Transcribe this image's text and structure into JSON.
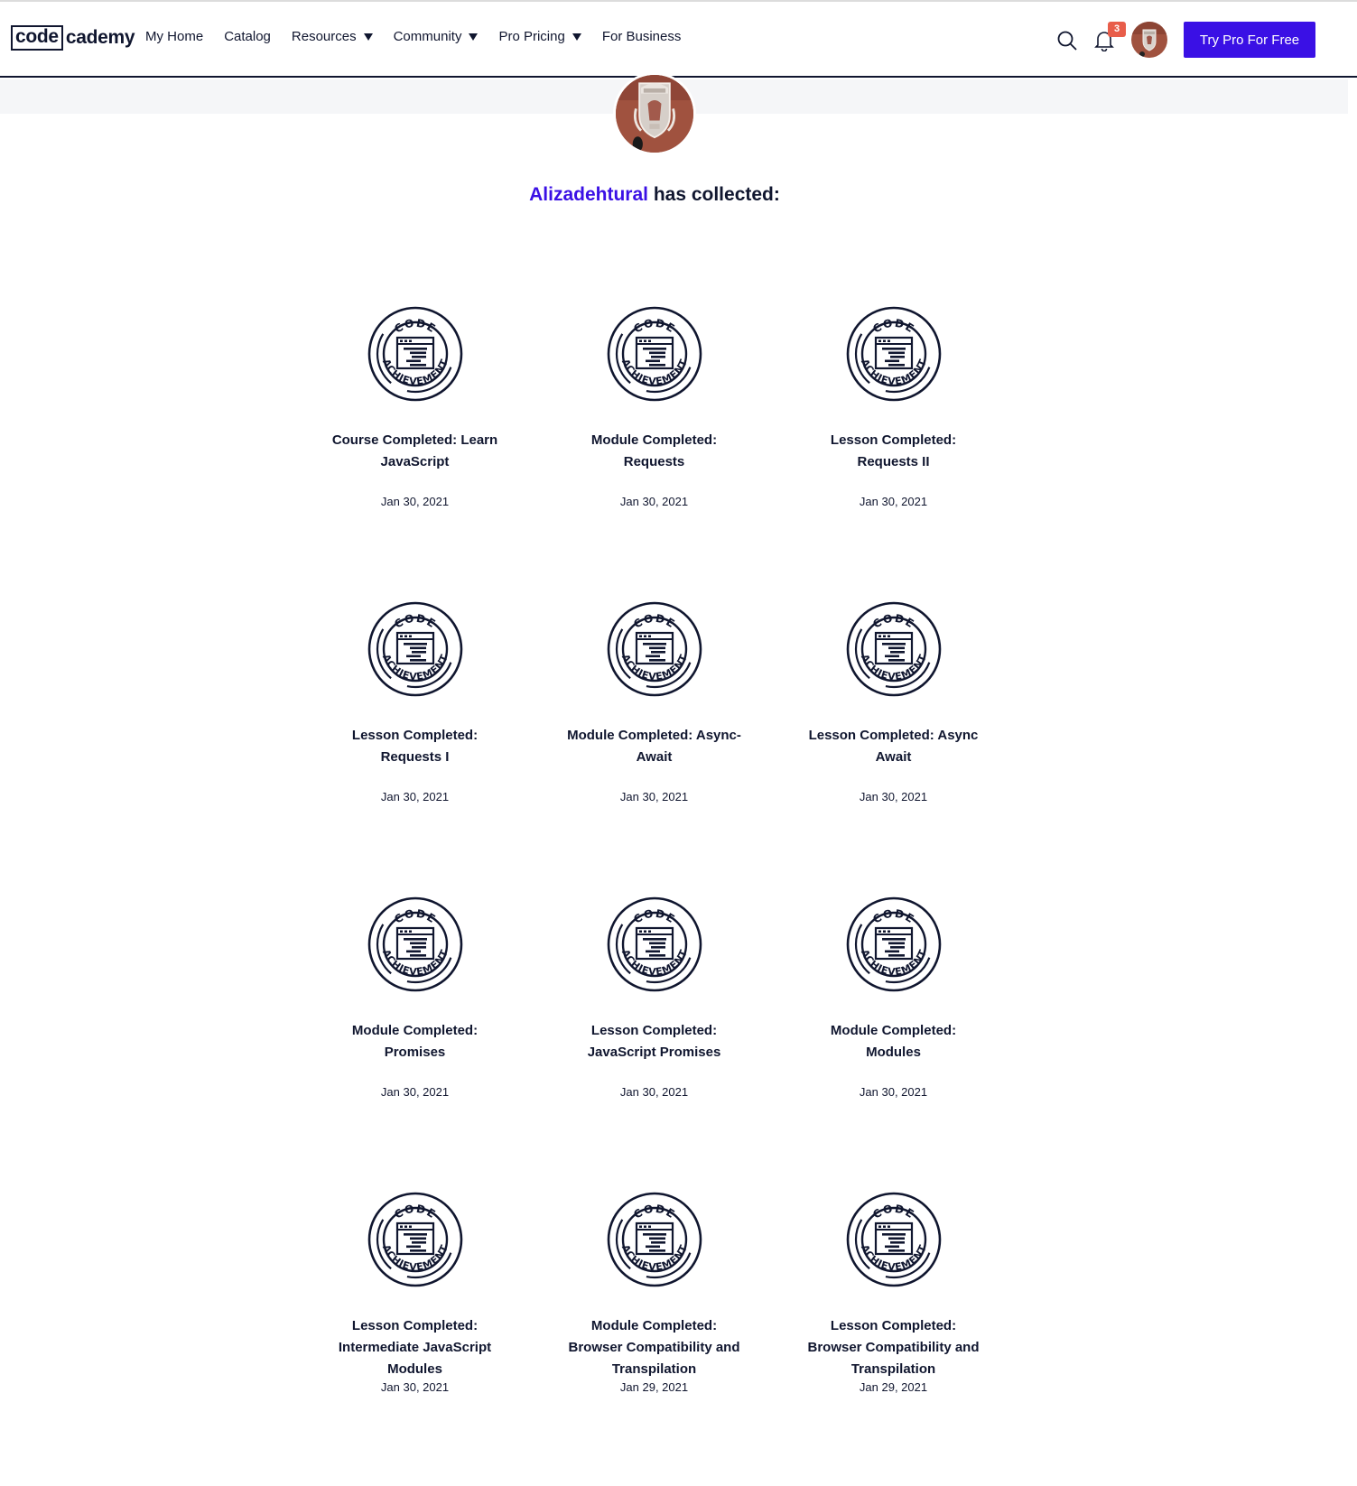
{
  "header": {
    "logo_left": "code",
    "logo_right": "cademy",
    "nav": [
      {
        "label": "My Home",
        "dropdown": false
      },
      {
        "label": "Catalog",
        "dropdown": false
      },
      {
        "label": "Resources",
        "dropdown": true
      },
      {
        "label": "Community",
        "dropdown": true
      },
      {
        "label": "Pro Pricing",
        "dropdown": true
      },
      {
        "label": "For Business",
        "dropdown": false
      }
    ],
    "notification_count": "3",
    "cta_label": "Try Pro For Free"
  },
  "profile": {
    "username": "Alizadehtural",
    "collected_suffix": " has collected:"
  },
  "badge_icon_text": {
    "top": "CODE",
    "bottom": "ACHIEVEMENT"
  },
  "achievements": [
    {
      "title": "Course Completed: Learn JavaScript",
      "date": "Jan 30, 2021"
    },
    {
      "title": "Module Completed: Requests",
      "date": "Jan 30, 2021"
    },
    {
      "title": "Lesson Completed: Requests II",
      "date": "Jan 30, 2021"
    },
    {
      "title": "Lesson Completed: Requests I",
      "date": "Jan 30, 2021"
    },
    {
      "title": "Module Completed: Async-Await",
      "date": "Jan 30, 2021"
    },
    {
      "title": "Lesson Completed: Async Await",
      "date": "Jan 30, 2021"
    },
    {
      "title": "Module Completed: Promises",
      "date": "Jan 30, 2021"
    },
    {
      "title": "Lesson Completed: JavaScript Promises",
      "date": "Jan 30, 2021"
    },
    {
      "title": "Module Completed: Modules",
      "date": "Jan 30, 2021"
    },
    {
      "title": "Lesson Completed: Intermediate JavaScript Modules",
      "date": "Jan 30, 2021"
    },
    {
      "title": "Module Completed: Browser Compatibility and Transpilation",
      "date": "Jan 29, 2021"
    },
    {
      "title": "Lesson Completed: Browser Compatibility and Transpilation",
      "date": "Jan 29, 2021"
    }
  ],
  "colors": {
    "brand": "#3a10e5",
    "navy": "#10162f",
    "badge_red": "#e85d4a",
    "avatar_bg": "#a0523f"
  }
}
